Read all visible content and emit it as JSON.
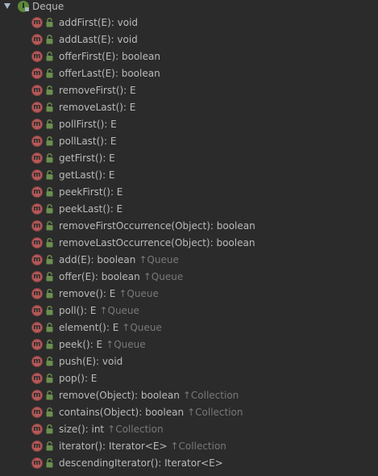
{
  "tree": {
    "class_name": "Deque",
    "class_icon_letter": "I",
    "method_icon_letter": "m",
    "colors": {
      "background": "#2b2b2b",
      "text": "#bbbbbb",
      "inherited": "#787878",
      "method_icon": "#b35959",
      "interface_icon": "#5c8a3a",
      "lock_icon": "#6a8f4e"
    },
    "methods": [
      {
        "signature": "addFirst(E): void",
        "inherited": ""
      },
      {
        "signature": "addLast(E): void",
        "inherited": ""
      },
      {
        "signature": "offerFirst(E): boolean",
        "inherited": ""
      },
      {
        "signature": "offerLast(E): boolean",
        "inherited": ""
      },
      {
        "signature": "removeFirst(): E",
        "inherited": ""
      },
      {
        "signature": "removeLast(): E",
        "inherited": ""
      },
      {
        "signature": "pollFirst(): E",
        "inherited": ""
      },
      {
        "signature": "pollLast(): E",
        "inherited": ""
      },
      {
        "signature": "getFirst(): E",
        "inherited": ""
      },
      {
        "signature": "getLast(): E",
        "inherited": ""
      },
      {
        "signature": "peekFirst(): E",
        "inherited": ""
      },
      {
        "signature": "peekLast(): E",
        "inherited": ""
      },
      {
        "signature": "removeFirstOccurrence(Object): boolean",
        "inherited": ""
      },
      {
        "signature": "removeLastOccurrence(Object): boolean",
        "inherited": ""
      },
      {
        "signature": "add(E): boolean",
        "inherited": "↑Queue"
      },
      {
        "signature": "offer(E): boolean",
        "inherited": "↑Queue"
      },
      {
        "signature": "remove(): E",
        "inherited": "↑Queue"
      },
      {
        "signature": "poll(): E",
        "inherited": "↑Queue"
      },
      {
        "signature": "element(): E",
        "inherited": "↑Queue"
      },
      {
        "signature": "peek(): E",
        "inherited": "↑Queue"
      },
      {
        "signature": "push(E): void",
        "inherited": ""
      },
      {
        "signature": "pop(): E",
        "inherited": ""
      },
      {
        "signature": "remove(Object): boolean",
        "inherited": "↑Collection"
      },
      {
        "signature": "contains(Object): boolean",
        "inherited": "↑Collection"
      },
      {
        "signature": "size(): int",
        "inherited": "↑Collection"
      },
      {
        "signature": "iterator(): Iterator<E>",
        "inherited": "↑Collection"
      },
      {
        "signature": "descendingIterator(): Iterator<E>",
        "inherited": ""
      }
    ]
  }
}
